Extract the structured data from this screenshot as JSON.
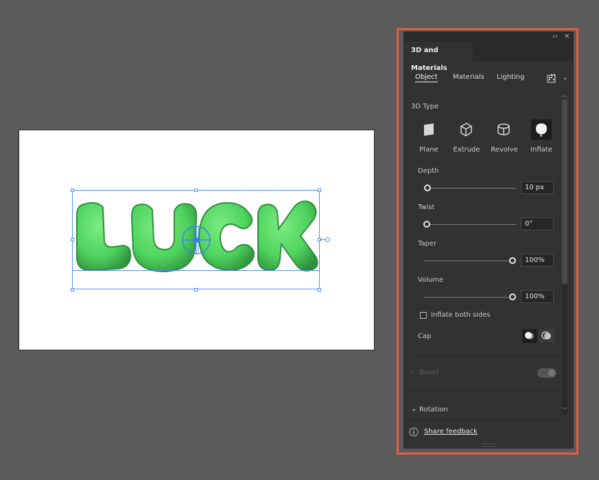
{
  "artwork": {
    "text": "LUCK",
    "fill_color": "#4fd35f"
  },
  "panel": {
    "title": "3D and Materials",
    "subtabs": [
      "Object",
      "Materials",
      "Lighting"
    ],
    "section_3d_type": "3D Type",
    "types": [
      {
        "label": "Plane",
        "icon": "plane-icon"
      },
      {
        "label": "Extrude",
        "icon": "extrude-icon"
      },
      {
        "label": "Revolve",
        "icon": "revolve-icon"
      },
      {
        "label": "Inflate",
        "icon": "inflate-icon",
        "selected": true
      }
    ],
    "depth": {
      "label": "Depth",
      "value": "10 px",
      "fraction": 0.0
    },
    "twist": {
      "label": "Twist",
      "value": "0°",
      "fraction": 0.0
    },
    "taper": {
      "label": "Taper",
      "value": "100%",
      "fraction": 1.0
    },
    "volume": {
      "label": "Volume",
      "value": "100%",
      "fraction": 1.0
    },
    "inflate_both_sides": {
      "label": "Inflate both sides",
      "checked": false
    },
    "cap": {
      "label": "Cap"
    },
    "bevel": {
      "label": "Bevel",
      "enabled": false
    },
    "rotation": {
      "label": "Rotation"
    },
    "feedback": {
      "label": "Share feedback"
    },
    "accent_color": "#ee5a3c"
  }
}
